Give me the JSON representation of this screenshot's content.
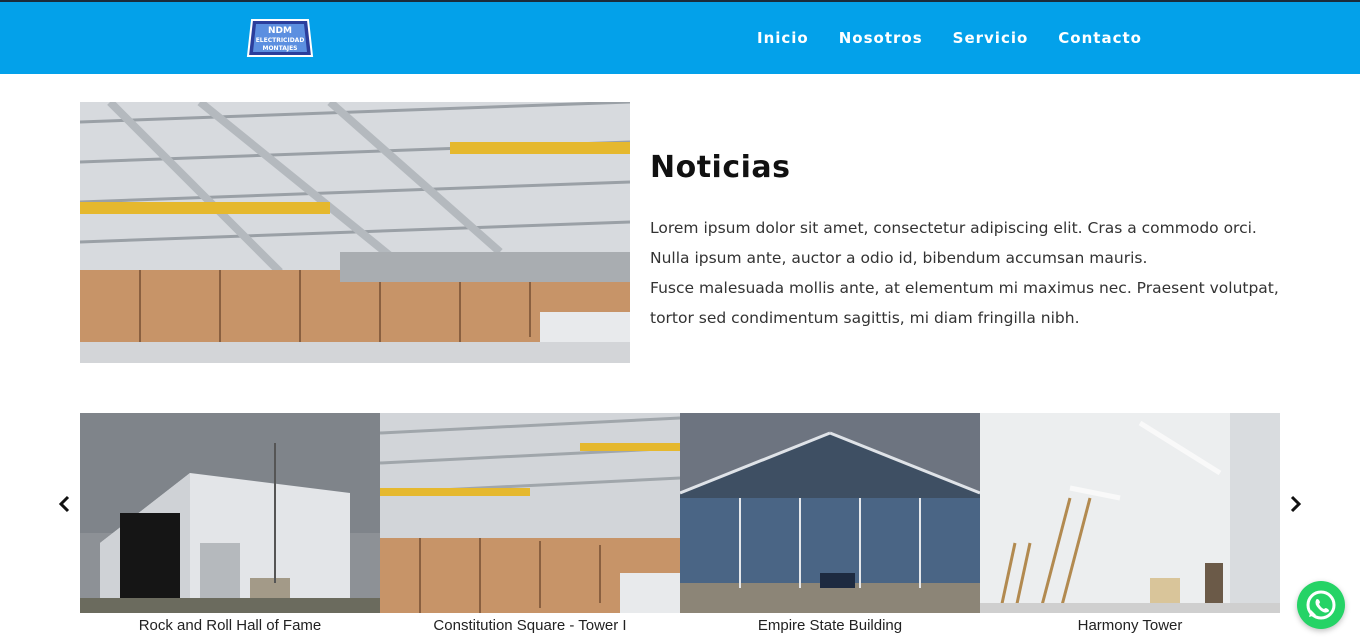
{
  "brand": {
    "logo_text": "NDM Electricidad Montajes"
  },
  "nav": {
    "items": [
      "Inicio",
      "Nosotros",
      "Servicio",
      "Contacto"
    ]
  },
  "news": {
    "title": "Noticias",
    "lines": [
      "Lorem ipsum dolor sit amet, consectetur adipiscing elit. Cras a commodo orci.",
      "Nulla ipsum ante, auctor a odio id, bibendum accumsan mauris.",
      "Fusce malesuada mollis ante, at elementum mi maximus nec. Praesent volutpat,",
      "tortor sed condimentum sagittis, mi diam fringilla nibh."
    ]
  },
  "carousel": {
    "slides": [
      {
        "caption": "Rock and Roll Hall of Fame"
      },
      {
        "caption": "Constitution Square - Tower I"
      },
      {
        "caption": "Empire State Building"
      },
      {
        "caption": "Harmony Tower"
      }
    ]
  },
  "icons": {
    "prev": "chevron-left-icon",
    "next": "chevron-right-icon",
    "whatsapp": "whatsapp-icon"
  },
  "colors": {
    "header": "#03a1ea",
    "whatsapp": "#25d366"
  }
}
